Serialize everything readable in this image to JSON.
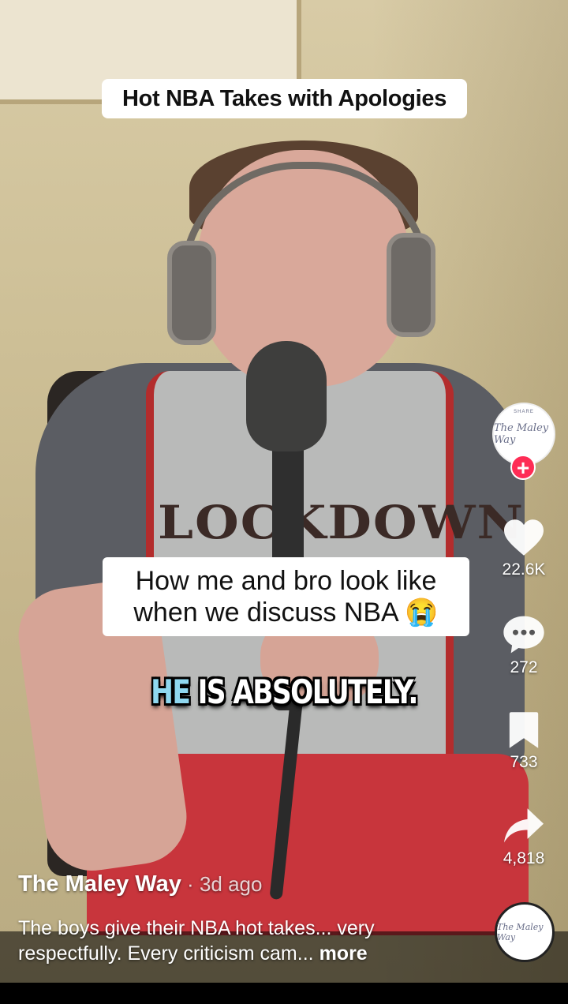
{
  "video": {
    "title_overlay": "Hot NBA Takes with Apologies",
    "meme_line1": "How me and bro look like",
    "meme_line2": "when we discuss NBA 😭",
    "caption_highlight": "HE",
    "caption_rest": " IS ABSOLUTELY.",
    "jersey_text": "LOCKDOWN"
  },
  "creator": {
    "avatar_text": "The Maley Way",
    "avatar_ring_text": "SHARE",
    "follow_symbol": "+"
  },
  "actions": {
    "likes": "22.6K",
    "comments": "272",
    "saves": "733",
    "shares": "4,818"
  },
  "post": {
    "author": "The Maley Way",
    "separator": " · ",
    "age": "3d ago",
    "description": "The boys give their NBA hot takes... very respectfully. Every criticism cam...",
    "more": "more"
  },
  "colors": {
    "follow": "#fe2c55",
    "caption_highlight": "#8fd8f0"
  },
  "icons": [
    "heart-icon",
    "comment-icon",
    "bookmark-icon",
    "share-icon"
  ]
}
